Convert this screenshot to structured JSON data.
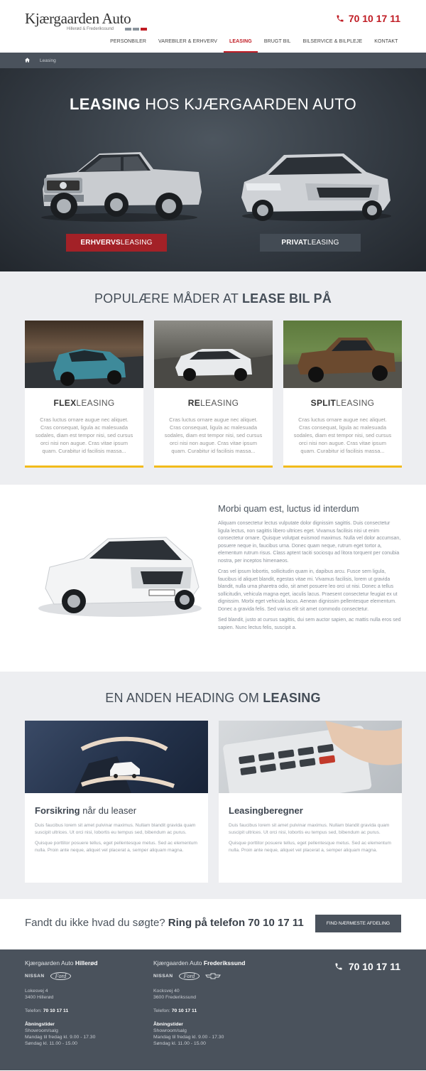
{
  "header": {
    "logo_name": "Kjærgaarden Auto",
    "logo_sub": "Hillerød & Frederikssund",
    "phone": "70 10 17 11",
    "nav": [
      {
        "label": "PERSONBILER",
        "active": false
      },
      {
        "label": "VAREBILER & ERHVERV",
        "active": false
      },
      {
        "label": "LEASING",
        "active": true
      },
      {
        "label": "BRUGT BIL",
        "active": false
      },
      {
        "label": "BILSERVICE & BILPLEJE",
        "active": false
      },
      {
        "label": "KONTAKT",
        "active": false
      }
    ]
  },
  "breadcrumb": {
    "home_icon": "home-icon",
    "current": "Leasing"
  },
  "hero": {
    "title_bold": "LEASING",
    "title_rest": " HOS KJÆRGAARDEN AUTO",
    "btn_business_bold": "ERHVERVS",
    "btn_business_rest": "LEASING",
    "btn_private_bold": "PRIVAT",
    "btn_private_rest": "LEASING"
  },
  "popular": {
    "title_rest": "POPULÆRE MÅDER AT ",
    "title_bold": "LEASE BIL PÅ",
    "cards": [
      {
        "bold": "FLEX",
        "rest": "LEASING",
        "text": "Cras luctus ornare augue nec aliquet. Cras consequat, ligula ac malesuada sodales, diam est tempor nisi, sed cursus orci nisi non augue. Cras vitae ipsum quam. Curabitur id facilisis massa..."
      },
      {
        "bold": "RE",
        "rest": "LEASING",
        "text": "Cras luctus ornare augue nec aliquet. Cras consequat, ligula ac malesuada sodales, diam est tempor nisi, sed cursus orci nisi non augue. Cras vitae ipsum quam. Curabitur id facilisis massa..."
      },
      {
        "bold": "SPLIT",
        "rest": "LEASING",
        "text": "Cras luctus ornare augue nec aliquet. Cras consequat, ligula ac malesuada sodales, diam est tempor nisi, sed cursus orci nisi non augue. Cras vitae ipsum quam. Curabitur id facilisis massa..."
      }
    ]
  },
  "about": {
    "heading": "Morbi quam est, luctus id interdum",
    "p1": "Aliquam consectetur lectus vulputate dolor dignissim sagittis. Duis consectetur ligula lectus, non sagittis libero ultrices eget. Vivamus facilisis nisi ut enim consectetur ornare. Quisque volutpat euismod maximus. Nulla vel dolor accumsan, posuere neque in, faucibus urna. Donec quam neque, rutrum eget tortor a, elementum rutrum risus. Class aptent taciti sociosqu ad litora torquent per conubia nostra, per inceptos himenaeos.",
    "p2": "Cras vel ipsum lobortis, sollicitudin quam in, dapibus arcu. Fusce sem ligula, faucibus id aliquet blandit, egestas vitae mi. Vivamus facilisis, lorem ut gravida blandit, nulla urna pharetra odio, sit amet posuere leo orci ut nisi. Donec a tellus sollicitudin, vehicula magna eget, iaculis lacus. Praesent consectetur feugiat ex ut dignissim. Morbi eget vehicula lacus. Aenean dignissim pellentesque elementum. Donec a gravida felis. Sed varius elit sit amet commodo consectetur.",
    "p3": "Sed blandit, justo at cursus sagittis, dui sem auctor sapien, ac mattis nulla eros sed sapien. Nunc lectus felis, suscipit a."
  },
  "section2": {
    "title_rest": "EN ANDEN HEADING OM ",
    "title_bold": "LEASING",
    "boxes": [
      {
        "bold": "Forsikring",
        "rest": " når du leaser",
        "p1": "Duis faucibus lorem sit amet pulvinar maximus. Nullam blandit gravida quam suscipit ultrices. Ut orci nisi, lobortis eu tempus sed, bibendum ac purus.",
        "p2": "Quisque porttitor posuere tellus, eget pellentesque metus. Sed ac elementum nulla. Proin ante neque, aliquet vel placerat a, semper aliquam magna."
      },
      {
        "bold": "Leasingberegner",
        "rest": "",
        "p1": "Duis faucibus lorem sit amet pulvinar maximus. Nullam blandit gravida quam suscipit ultrices. Ut orci nisi, lobortis eu tempus sed, bibendum ac purus.",
        "p2": "Quisque porttitor posuere tellus, eget pellentesque metus. Sed ac elementum nulla. Proin ante neque, aliquet vel placerat a, semper aliquam magna."
      }
    ]
  },
  "cta": {
    "question": "Fandt du ikke hvad du søgte? ",
    "bold": "Ring på telefon 70 10 17 11",
    "button": "FIND NÆRMESTE AFDELING"
  },
  "footer": {
    "phone": "70 10 17 11",
    "locations": [
      {
        "brand": "Kjærgaarden Auto ",
        "city": "Hillerød",
        "street": "Lokesvej 4",
        "zip": "3400 Hillerød",
        "tel_label": "Telefon: ",
        "tel": "70 10 17 11",
        "hours_title": "Åbningstider",
        "hours_1": "Showroom/salg",
        "hours_2": "Mandag til fredag kl. 9.00 - 17.30",
        "hours_3": "Søndag kl. 11.00 - 15.00"
      },
      {
        "brand": "Kjærgaarden Auto ",
        "city": "Frederikssund",
        "street": "Kocksvej 40",
        "zip": "3600 Frederikssund",
        "tel_label": "Telefon: ",
        "tel": "70 10 17 11",
        "hours_title": "Åbningstider",
        "hours_1": "Showroom/salg",
        "hours_2": "Mandag til fredag kl. 9.00 - 17.30",
        "hours_3": "Søndag kl. 11.00 - 15.00"
      }
    ],
    "brand_nissan": "NISSAN",
    "brand_ford": "Ford"
  },
  "colors": {
    "accent": "#c01c24",
    "dark": "#4a525c",
    "yellow": "#f2bb1c"
  }
}
